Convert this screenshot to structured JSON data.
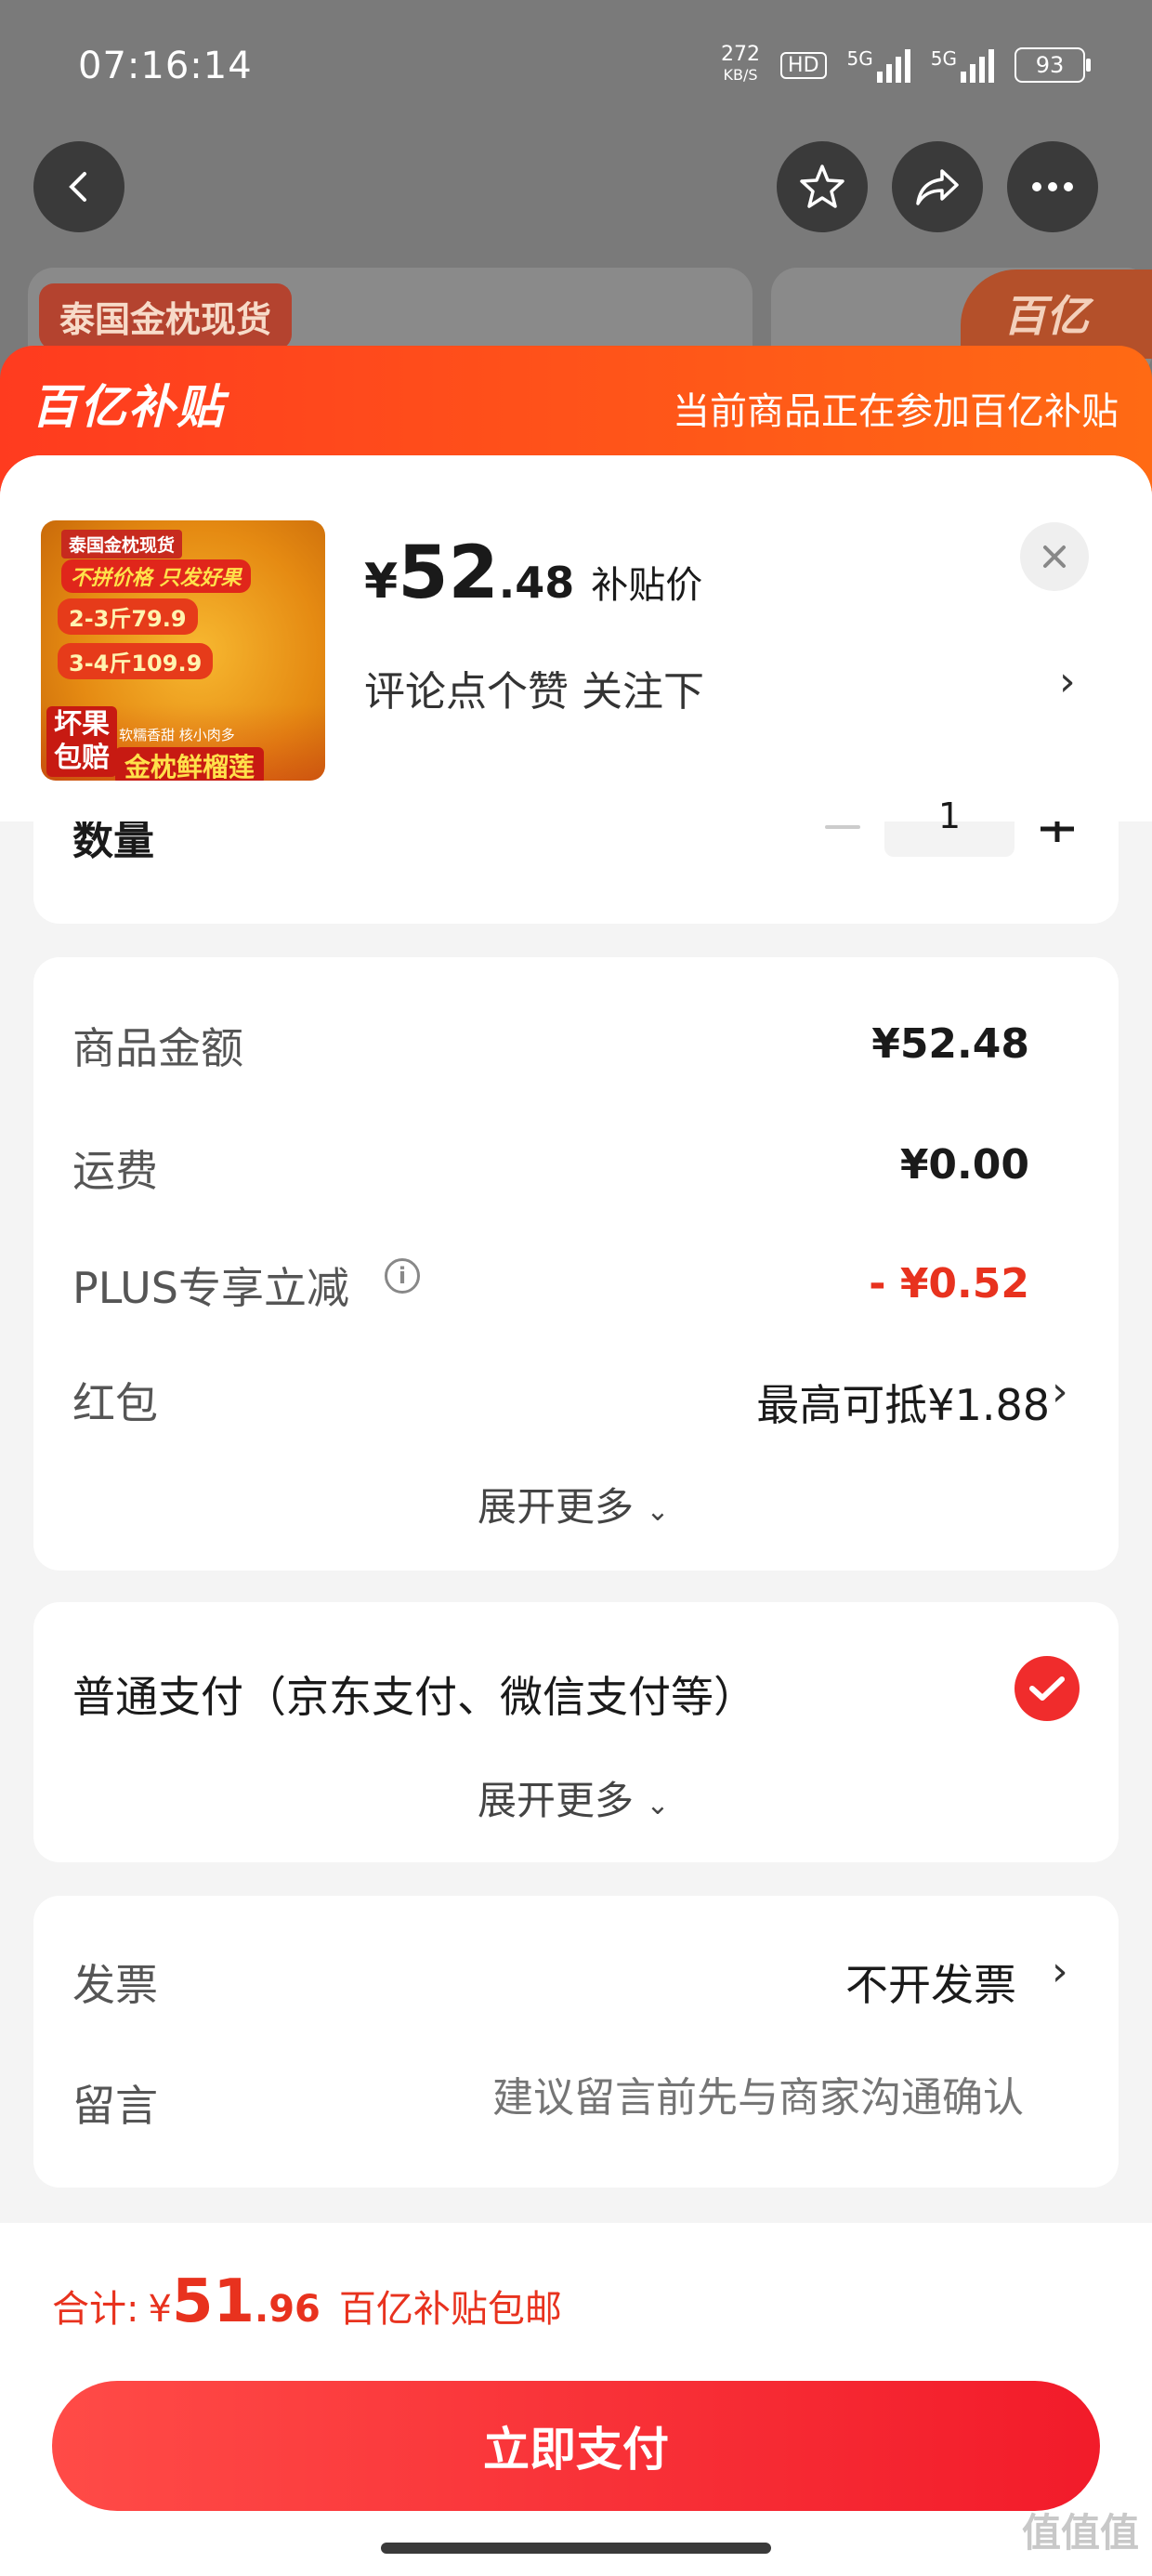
{
  "status_bar": {
    "time": "07:16:14",
    "net_speed": "272",
    "net_unit": "KB/S",
    "hd": "HD",
    "sig1": "5G",
    "sig2": "5G",
    "battery": "93"
  },
  "background": {
    "peek_tag": "泰国金枕现货",
    "peek_logo": "百亿"
  },
  "header": {
    "brand": "百亿补贴",
    "notice": "当前商品正在参加百亿补贴"
  },
  "product": {
    "thumb": {
      "tag": "泰国金枕现货",
      "line1": "不拼价格 只发好果",
      "price1": "2-3斤79.9",
      "price2": "3-4斤109.9",
      "badge1": "坏果",
      "badge2": "包赔",
      "small": "软糯香甜 核小肉多",
      "name": "金枕鲜榴莲"
    },
    "currency": "¥",
    "price_int": "52",
    "price_dec": ".48",
    "price_tag": "补贴价",
    "desc": "评论点个赞  关注下"
  },
  "quantity": {
    "label": "数量",
    "value": "1"
  },
  "summary": {
    "rows": [
      {
        "label": "商品金额",
        "value": "¥52.48"
      },
      {
        "label": "运费",
        "value": "¥0.00"
      },
      {
        "label": "PLUS专享立减",
        "value": "- ¥0.52"
      },
      {
        "label": "红包",
        "value": "最高可抵¥1.88"
      }
    ],
    "expand": "展开更多"
  },
  "payment": {
    "method": "普通支付（京东支付、微信支付等）",
    "expand": "展开更多"
  },
  "extra": {
    "invoice_label": "发票",
    "invoice_value": "不开发票",
    "note_label": "留言",
    "note_placeholder": "建议留言前先与商家沟通确认"
  },
  "total": {
    "prefix": "合计:",
    "currency": "¥",
    "int": "51",
    "dec": ".96",
    "suffix": "百亿补贴包邮"
  },
  "pay_button": "立即支付",
  "watermark": "值值值"
}
